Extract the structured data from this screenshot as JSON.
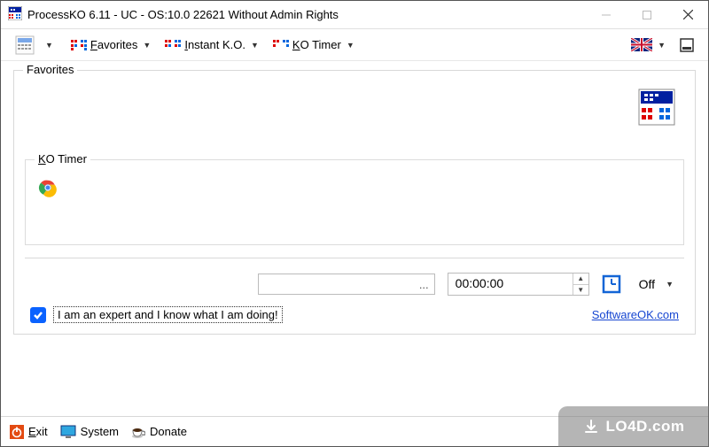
{
  "window": {
    "title": "ProcessKO 6.11 - UC  - OS:10.0 22621 Without Admin Rights"
  },
  "toolbar": {
    "favorites_prefix": "F",
    "favorites_rest": "avorites",
    "instant_prefix": "I",
    "instant_rest": "nstant K.O.",
    "kotimer_prefix": "K",
    "kotimer_rest": "O Timer"
  },
  "group": {
    "favorites_label": "Favorites",
    "kotimer_label_prefix": "K",
    "kotimer_label_rest": "O Timer"
  },
  "controls": {
    "path_value": "...",
    "time_value": "00:00:00",
    "off_label": "Off"
  },
  "expert": {
    "checked": true,
    "label": "I am an expert and I know what I am doing!"
  },
  "link": {
    "site": "SoftwareOK.com"
  },
  "statusbar": {
    "exit_prefix": "E",
    "exit_rest": "xit",
    "system": "System",
    "donate": "Donate"
  },
  "watermark": "LO4D.com"
}
